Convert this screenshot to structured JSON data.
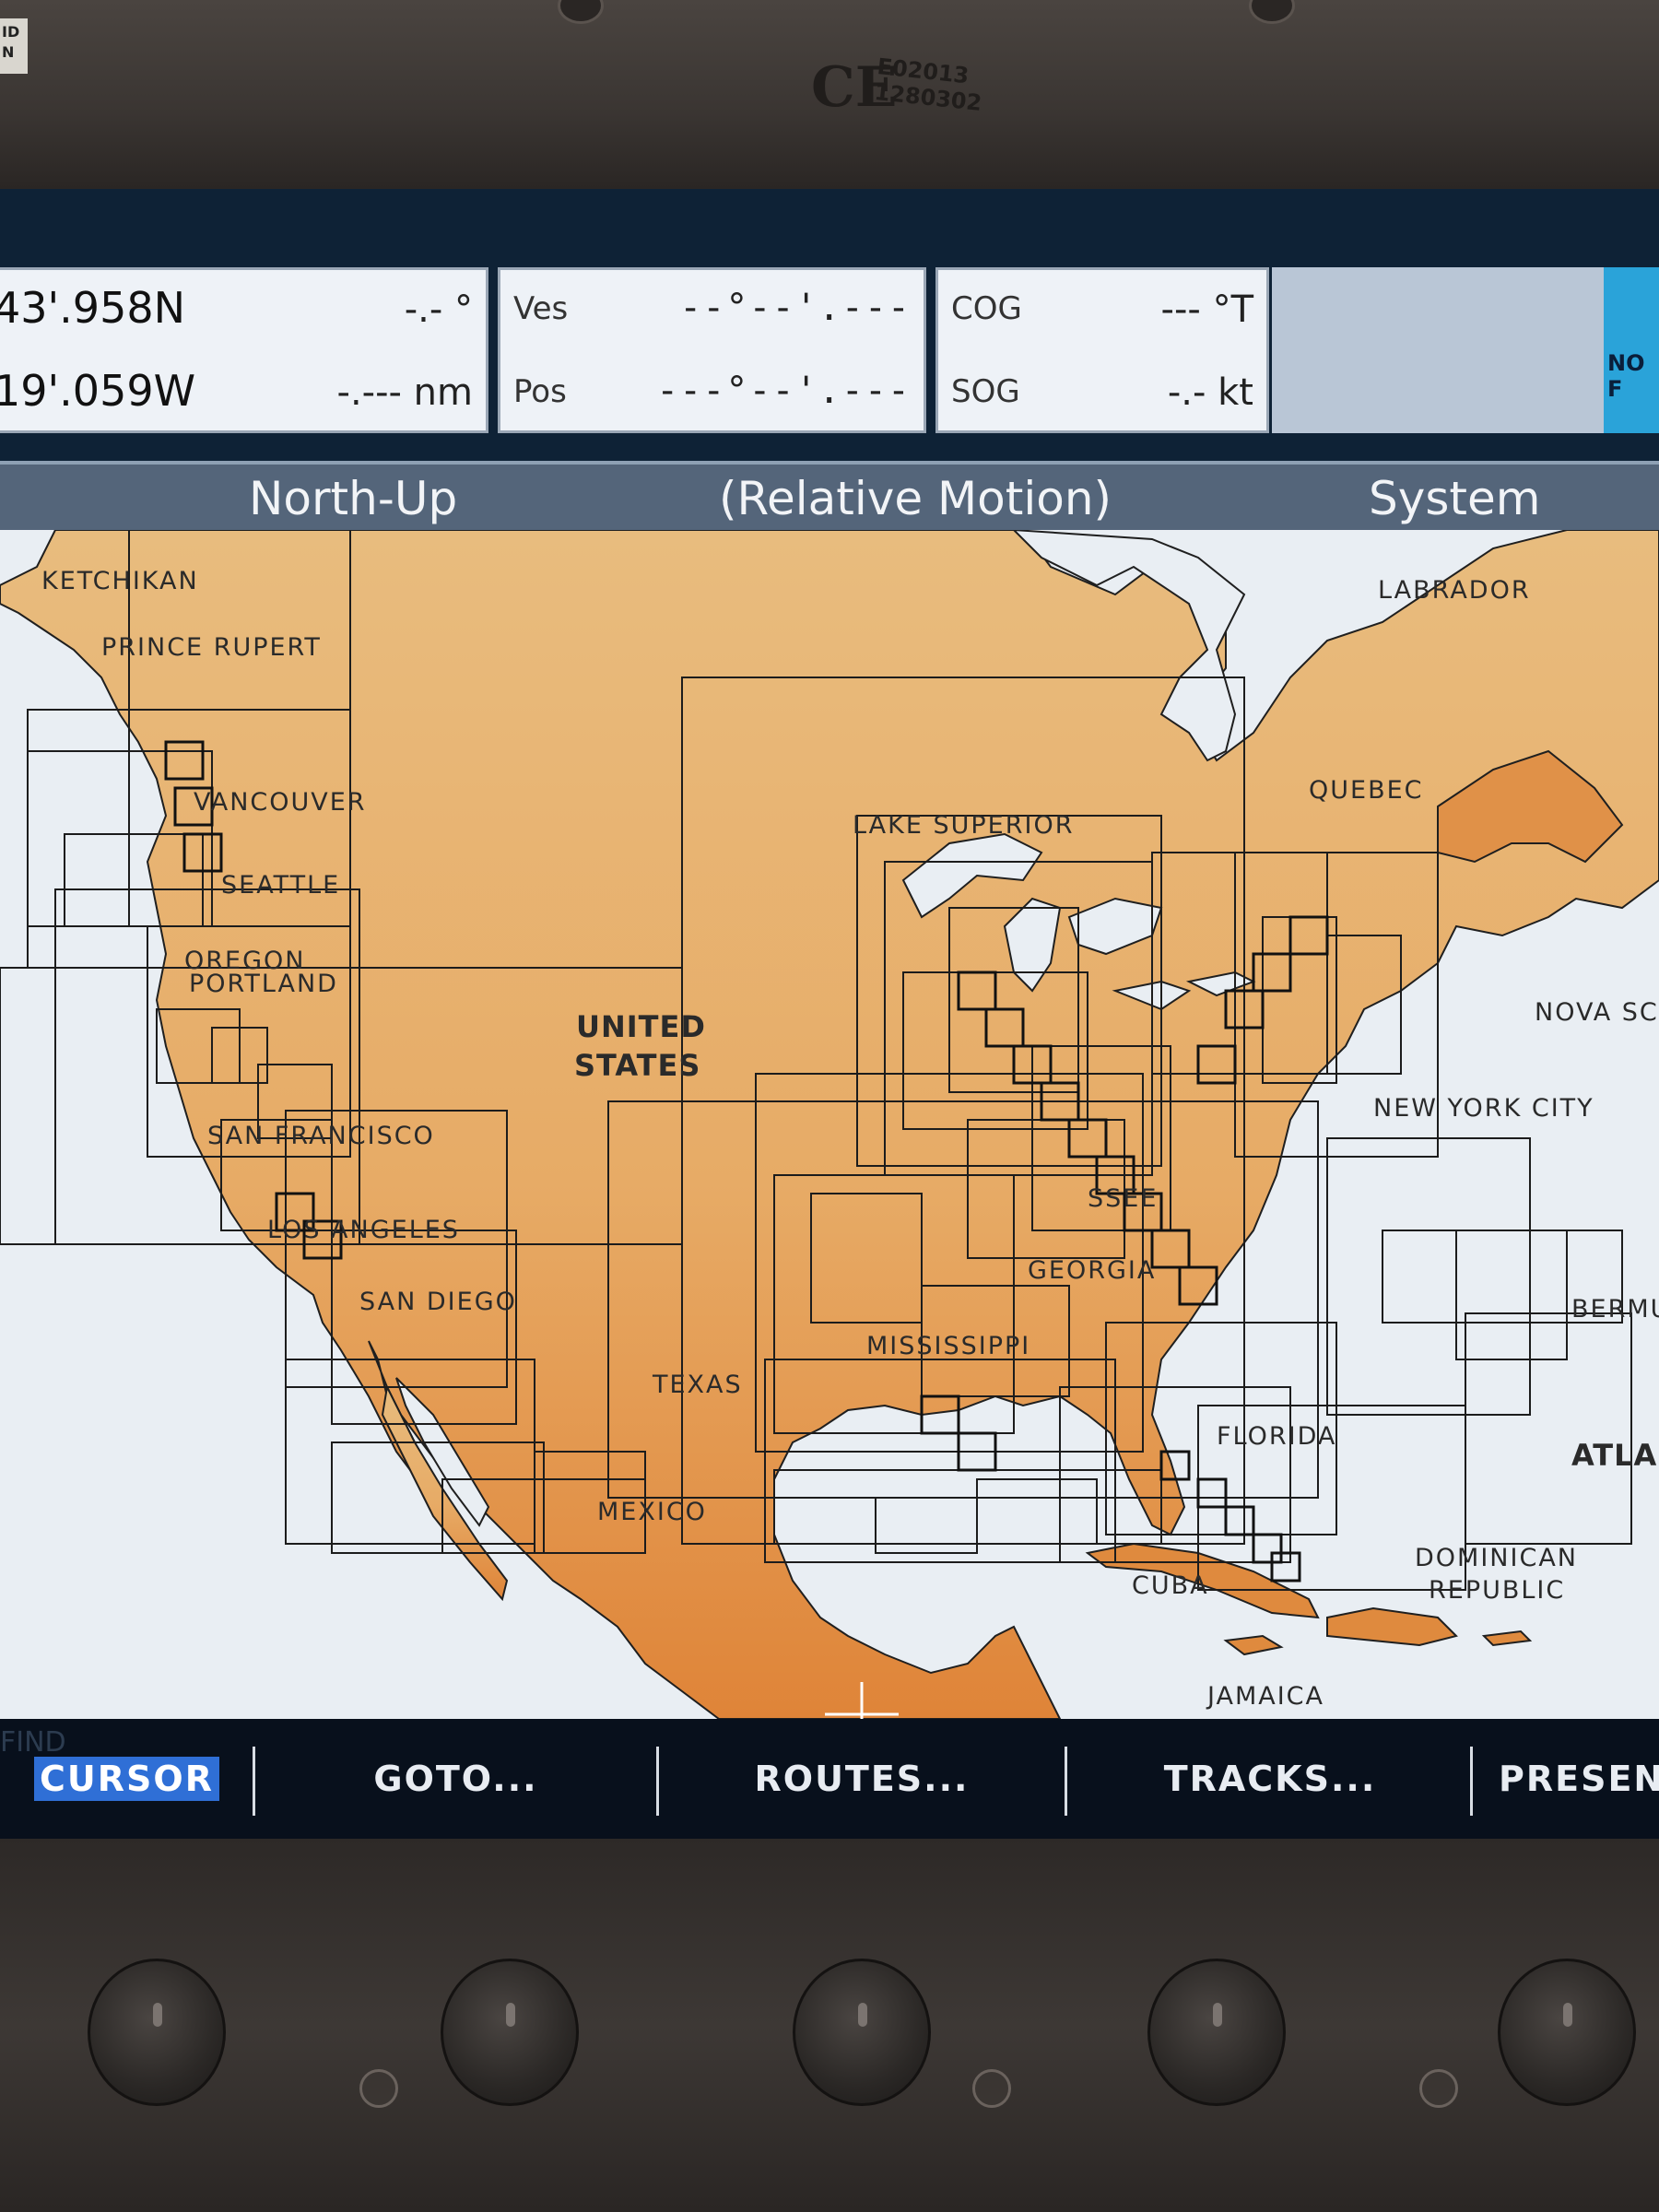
{
  "device": {
    "badge_text": "ID\nN",
    "ce_mark": "CE",
    "ce_code_1": "E02013",
    "ce_code_2": "1280302"
  },
  "databar": {
    "position": {
      "lat": "43'.958N",
      "lon": "19'.059W",
      "bearing": "-.- °",
      "range": "-.--- nm"
    },
    "vessel": {
      "ves_label": "Ves",
      "ves_value": "--°--'.---",
      "pos_label": "Pos",
      "pos_value": "---°--'.---"
    },
    "motion": {
      "cog_label": "COG",
      "cog_value": "--- °T",
      "sog_label": "SOG",
      "sog_value": "-.- kt"
    },
    "gps_status": "NO F"
  },
  "modebar": {
    "orientation": "North-Up",
    "motion_mode": "(Relative Motion)",
    "source": "System"
  },
  "map_labels": [
    {
      "text": "KETCHIKAN"
    },
    {
      "text": "PRINCE RUPERT"
    },
    {
      "text": "VANCOUVER"
    },
    {
      "text": "SEATTLE"
    },
    {
      "text": "OREGON"
    },
    {
      "text": "PORTLAND"
    },
    {
      "text": "UNITED"
    },
    {
      "text": "STATES"
    },
    {
      "text": "SAN FRANCISCO"
    },
    {
      "text": "LOS ANGELES"
    },
    {
      "text": "SAN DIEGO"
    },
    {
      "text": "TEXAS"
    },
    {
      "text": "MEXICO"
    },
    {
      "text": "LAKE SUPERIOR"
    },
    {
      "text": "LABRADOR"
    },
    {
      "text": "QUEBEC"
    },
    {
      "text": "NOVA SC"
    },
    {
      "text": "NEW YORK CITY"
    },
    {
      "text": "SSEE"
    },
    {
      "text": "GEORGIA"
    },
    {
      "text": "MISSISSIPPI"
    },
    {
      "text": "FLORIDA"
    },
    {
      "text": "BERMU"
    },
    {
      "text": "ATLA"
    },
    {
      "text": "CUBA"
    },
    {
      "text": "DOMINICAN"
    },
    {
      "text": "REPUBLIC"
    },
    {
      "text": "JAMAICA"
    }
  ],
  "softkeys": {
    "find_ghost": "FIND",
    "cursor": "CURSOR",
    "goto": "GOTO...",
    "routes": "ROUTES...",
    "tracks": "TRACKS...",
    "present": "PRESEN"
  },
  "colors": {
    "land_light": "#e8b878",
    "land_dark": "#e08a3c",
    "water": "#e9eef3",
    "modebar": "#54657a",
    "softbar": "#08101c",
    "cursor_highlight": "#2f6fd6"
  }
}
